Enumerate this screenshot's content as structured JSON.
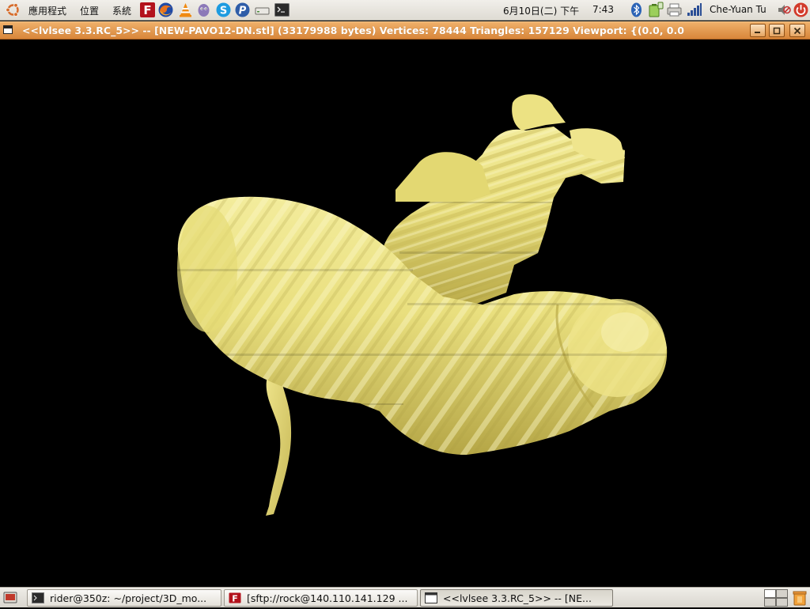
{
  "top_panel": {
    "menus": [
      {
        "label": "應用程式"
      },
      {
        "label": "位置"
      },
      {
        "label": "系統"
      }
    ],
    "launchers": [
      {
        "icon": "filezilla-icon"
      },
      {
        "icon": "firefox-icon"
      },
      {
        "icon": "vlc-icon"
      },
      {
        "icon": "pidgin-icon"
      },
      {
        "icon": "skype-icon"
      },
      {
        "icon": "pidgin-p-icon"
      },
      {
        "icon": "drive-icon"
      },
      {
        "icon": "terminal-icon"
      }
    ],
    "clock": {
      "date": "6月10日(二) 下午",
      "time": "7:43"
    },
    "tray": [
      "bluetooth-icon",
      "battery-icon",
      "printer-icon",
      "network-signal-icon"
    ],
    "user": "Che-Yuan Tu",
    "power_icons": [
      "volume-icon",
      "power-icon"
    ]
  },
  "window": {
    "title": "<<lvlsee 3.3.RC_5>>  --  [NEW-PAVO12-DN.stl] (33179988 bytes)   Vertices: 78444   Triangles: 157129   Viewport: {(0.0, 0.0",
    "buttons": [
      "minimize",
      "maximize",
      "close"
    ]
  },
  "viewport": {
    "background": "#000000",
    "model_color": "#e9df7e"
  },
  "taskbar": {
    "tasks": [
      {
        "label": "rider@350z: ~/project/3D_mo...",
        "icon": "terminal-icon",
        "active": false
      },
      {
        "label": "[sftp://rock@140.110.141.129 ...",
        "icon": "filezilla-icon",
        "active": false
      },
      {
        "label": "<<lvlsee 3.3.RC_5>>  --  [NE...",
        "icon": "window-icon",
        "active": true
      }
    ]
  },
  "colors": {
    "title_bar": "#dc8a3f",
    "panel": "#e6e3dc",
    "model_highlight": "#f3ec9c",
    "model_shadow": "#b5a646"
  }
}
